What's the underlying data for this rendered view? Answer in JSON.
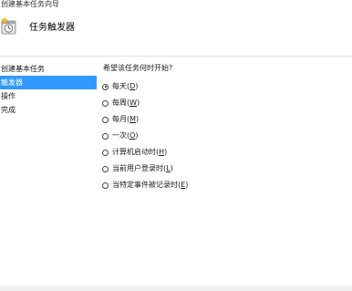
{
  "window": {
    "title": "创建基本任务向导"
  },
  "header": {
    "icon": "task-wizard-icon",
    "title": "任务触发器"
  },
  "steps": [
    {
      "label": "创建基本任务",
      "active": false
    },
    {
      "label": "触发器",
      "active": true
    },
    {
      "label": "操作",
      "active": false
    },
    {
      "label": "完成",
      "active": false
    }
  ],
  "main": {
    "question": "希望该任务何时开始?",
    "options": [
      {
        "text": "每天(",
        "key": "D",
        "end": ")",
        "checked": true
      },
      {
        "text": "每周(",
        "key": "W",
        "end": ")",
        "checked": false
      },
      {
        "text": "每月(",
        "key": "M",
        "end": ")",
        "checked": false
      },
      {
        "text": "一次(",
        "key": "O",
        "end": ")",
        "checked": false
      },
      {
        "text": "计算机启动时(",
        "key": "H",
        "end": ")",
        "checked": false
      },
      {
        "text": "当前用户登录时(",
        "key": "L",
        "end": ")",
        "checked": false
      },
      {
        "text": "当特定事件被记录时(",
        "key": "E",
        "end": ")",
        "checked": false
      }
    ]
  },
  "colors": {
    "selection": "#3399ff",
    "background": "#ffffff"
  }
}
